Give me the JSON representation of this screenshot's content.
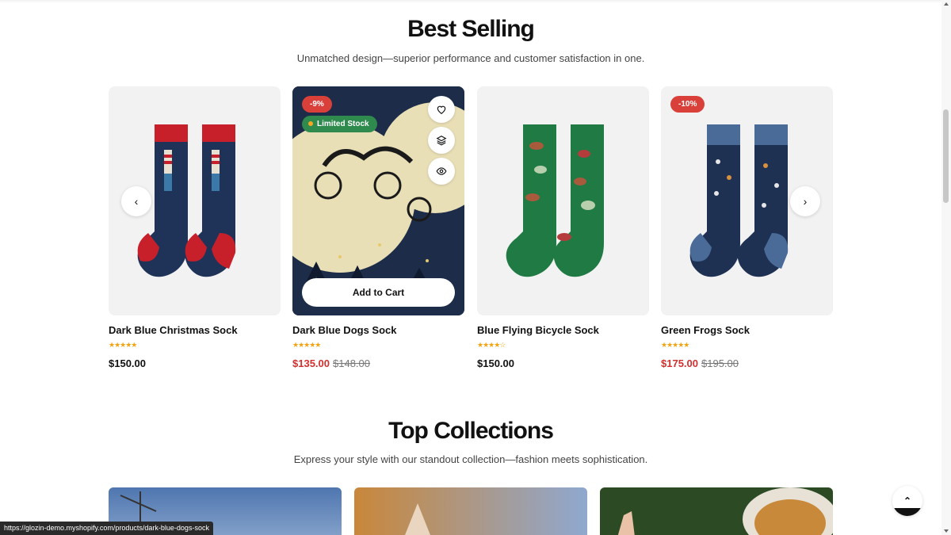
{
  "best_selling": {
    "title": "Best Selling",
    "subtitle": "Unmatched design—superior performance and customer satisfaction in one."
  },
  "products": [
    {
      "name": "Dark Blue Christmas Sock",
      "rating": "★★★★★",
      "price": "$150.00",
      "old_price": "",
      "sale_badge": ""
    },
    {
      "name": "Dark Blue Dogs Sock",
      "rating": "★★★★★",
      "price": "$135.00",
      "old_price": "$148.00",
      "sale_badge": "-9%",
      "stock_badge": "Limited Stock",
      "add_to_cart": "Add to Cart"
    },
    {
      "name": "Blue Flying Bicycle Sock",
      "rating": "★★★★☆",
      "price": "$150.00",
      "old_price": "",
      "sale_badge": ""
    },
    {
      "name": "Green Frogs Sock",
      "rating": "★★★★★",
      "price": "$175.00",
      "old_price": "$195.00",
      "sale_badge": "-10%"
    }
  ],
  "top_collections": {
    "title": "Top Collections",
    "subtitle": "Express your style with our standout collection—fashion meets sophistication."
  },
  "status_url": "https://glozin-demo.myshopify.com/products/dark-blue-dogs-sock",
  "colors": {
    "sale_red": "#d0302f",
    "badge_red": "#d9403a",
    "stock_green": "#2f8a4e",
    "star_gold": "#f2a30f"
  },
  "icons": [
    "chevron-left-icon",
    "chevron-right-icon",
    "heart-icon",
    "layers-icon",
    "eye-icon",
    "double-chevron-up-icon"
  ]
}
